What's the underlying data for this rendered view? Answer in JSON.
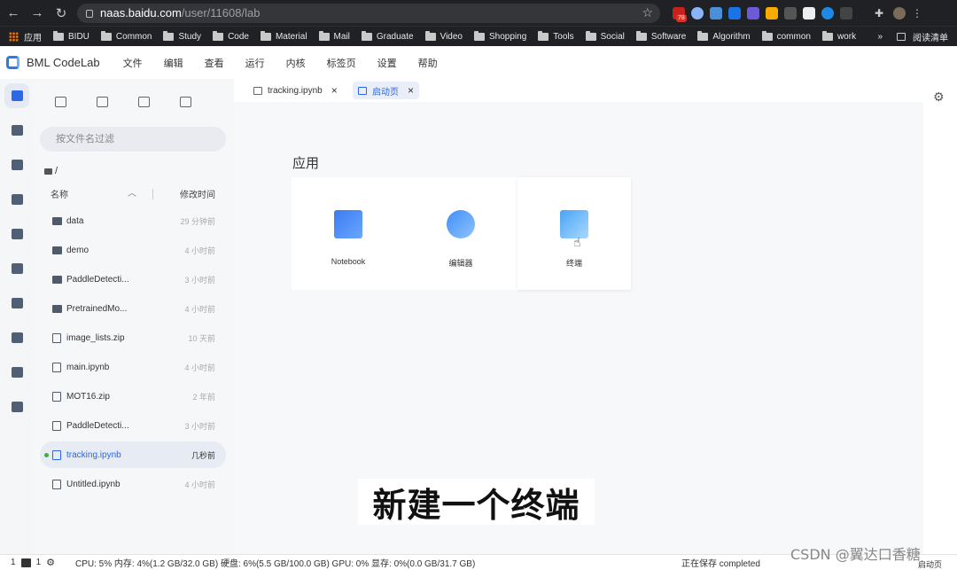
{
  "browser": {
    "url_host": "naas.baidu.com",
    "url_path": "/user/11608/lab",
    "ext_badge": "78",
    "bookmarks": [
      "应用",
      "BIDU",
      "Common",
      "Study",
      "Code",
      "Material",
      "Mail",
      "Graduate",
      "Video",
      "Shopping",
      "Tools",
      "Social",
      "Software",
      "Algorithm",
      "common",
      "work"
    ],
    "overflow": "»",
    "reading_list": "阅读清单"
  },
  "app": {
    "brand": "BML CodeLab",
    "menu": [
      "文件",
      "编辑",
      "查看",
      "运行",
      "内核",
      "标签页",
      "设置",
      "帮助"
    ]
  },
  "filepanel": {
    "search_placeholder": "按文件名过滤",
    "breadcrumb": "/",
    "col_name": "名称",
    "col_time": "修改时间",
    "files": [
      {
        "name": "data",
        "time": "29 分钟前",
        "type": "folder"
      },
      {
        "name": "demo",
        "time": "4 小时前",
        "type": "folder"
      },
      {
        "name": "PaddleDetecti...",
        "time": "3 小时前",
        "type": "folder"
      },
      {
        "name": "PretrainedMo...",
        "time": "4 小时前",
        "type": "folder"
      },
      {
        "name": "image_lists.zip",
        "time": "10 天前",
        "type": "file"
      },
      {
        "name": "main.ipynb",
        "time": "4 小时前",
        "type": "file"
      },
      {
        "name": "MOT16.zip",
        "time": "2 年前",
        "type": "file"
      },
      {
        "name": "PaddleDetecti...",
        "time": "3 小时前",
        "type": "file"
      },
      {
        "name": "tracking.ipynb",
        "time": "几秒前",
        "type": "file",
        "active": true
      },
      {
        "name": "Untitled.ipynb",
        "time": "4 小时前",
        "type": "file"
      }
    ]
  },
  "tabs": [
    {
      "label": "tracking.ipynb",
      "active": false
    },
    {
      "label": "启动页",
      "active": true
    }
  ],
  "launcher": {
    "section": "应用",
    "cards": [
      {
        "label": "Notebook",
        "icon": "notebook-icon"
      },
      {
        "label": "编辑器",
        "icon": "editor-icon"
      },
      {
        "label": "终端",
        "icon": "terminal-icon"
      }
    ]
  },
  "subtitle": "新建一个终端",
  "status": {
    "kernels": "1",
    "terminals": "1",
    "metrics": "CPU:  5% 内存:  4%(1.2 GB/32.0 GB)  硬盘:  6%(5.5 GB/100.0 GB)  GPU:  0%  显存:  0%(0.0 GB/31.7 GB)",
    "save": "正在保存 completed",
    "launcher": "启动页"
  },
  "watermark": "CSDN @翼达口香糖"
}
